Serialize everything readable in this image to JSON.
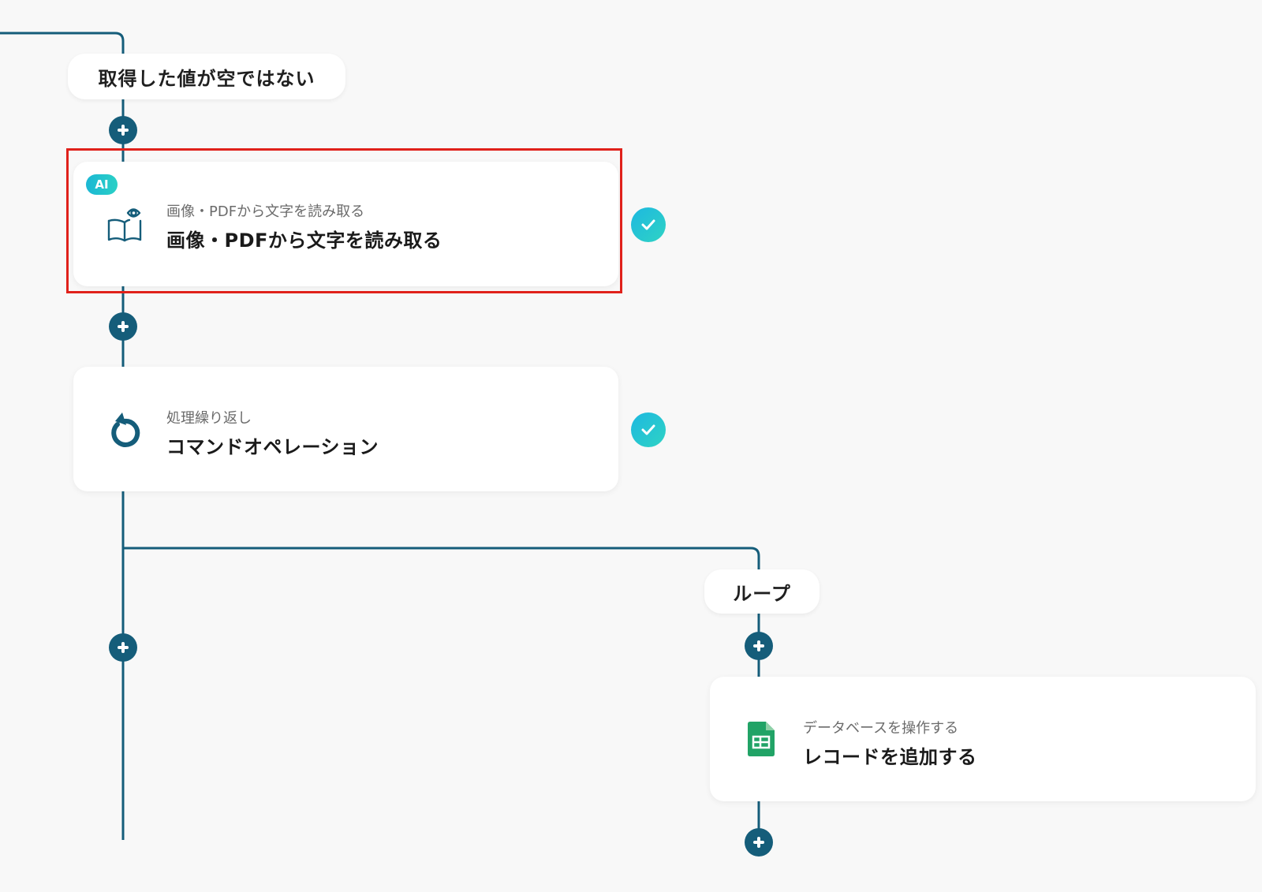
{
  "flow": {
    "condition_label": "取得した値が空ではない",
    "loop_label": "ループ",
    "steps": [
      {
        "id": "ocr",
        "badge": "AI",
        "subtitle": "画像・PDFから文字を読み取る",
        "title": "画像・PDFから文字を読み取る",
        "icon": "book-eye-icon",
        "status": "completed"
      },
      {
        "id": "loop",
        "subtitle": "処理繰り返し",
        "title": "コマンドオペレーション",
        "icon": "loop-arrow-icon",
        "status": "completed"
      },
      {
        "id": "sheets",
        "subtitle": "データベースを操作する",
        "title": "レコードを追加する",
        "icon": "google-sheets-icon",
        "status": "pending"
      }
    ]
  },
  "colors": {
    "connector": "#155d7a",
    "check_gradient_start": "#1db8e0",
    "check_gradient_end": "#2fd3c4",
    "highlight": "#e0211b",
    "sheets_green": "#21a366"
  }
}
